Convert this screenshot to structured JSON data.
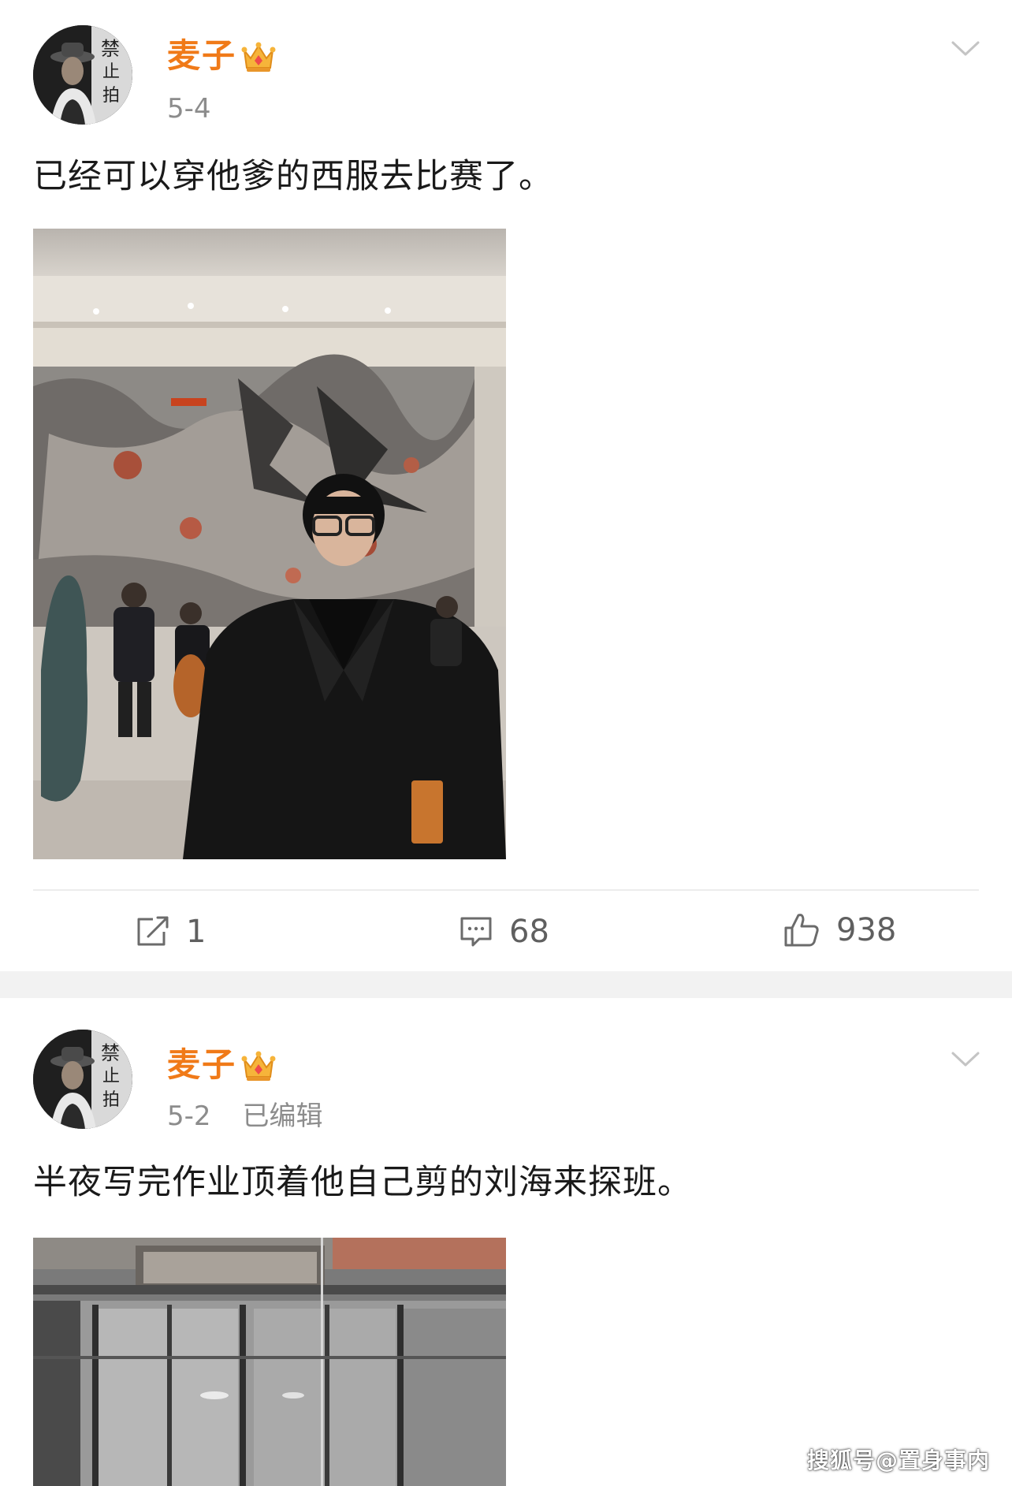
{
  "posts": [
    {
      "author": "麦子",
      "date": "5-4",
      "text": "已经可以穿他爹的西服去比赛了。",
      "actions": {
        "repost_count": "1",
        "comment_count": "68",
        "like_count": "938"
      }
    },
    {
      "author": "麦子",
      "date": "5-2",
      "edited_label": "已编辑",
      "text": "半夜写完作业顶着他自己剪的刘海来探班。"
    }
  ],
  "watermark": "搜狐号@置身事内",
  "icons": {
    "badge": "crown-icon",
    "menu": "chevron-down-icon",
    "repost": "repost-icon",
    "comment": "comment-icon",
    "like": "thumbs-up-icon"
  },
  "colors": {
    "username": "#f07a18",
    "meta": "#8c8c8c",
    "separator": "#f2f2f2",
    "action_text": "#5f5f5f"
  }
}
